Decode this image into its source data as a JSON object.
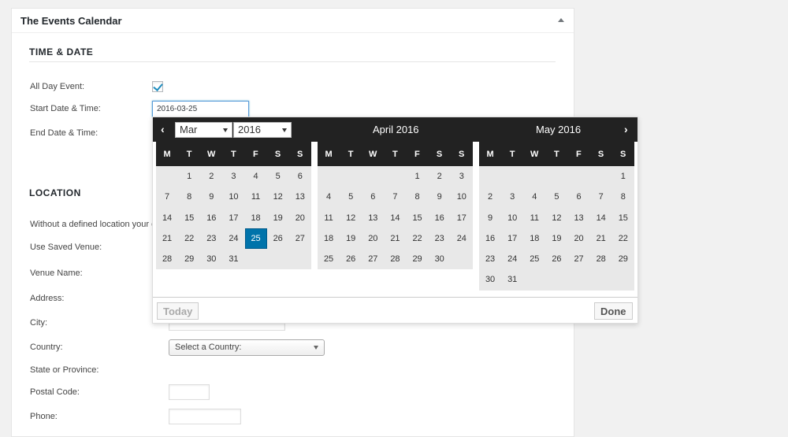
{
  "panel": {
    "title": "The Events Calendar"
  },
  "time_date": {
    "heading": "TIME & DATE",
    "all_day_label": "All Day Event:",
    "all_day_checked": true,
    "start_label": "Start Date & Time:",
    "start_value": "2016-03-25",
    "end_label": "End Date & Time:"
  },
  "location": {
    "heading": "LOCATION",
    "notice": "Without a defined location your e",
    "use_saved_venue_label": "Use Saved Venue:",
    "venue_name_label": "Venue Name:",
    "address_label": "Address:",
    "city_label": "City:",
    "country_label": "Country:",
    "country_select": "Select a Country:",
    "state_label": "State or Province:",
    "postal_label": "Postal Code:",
    "phone_label": "Phone:"
  },
  "datepicker": {
    "prev": "‹",
    "next": "›",
    "month_select": "Mar",
    "year_select": "2016",
    "weekdays": [
      "M",
      "T",
      "W",
      "T",
      "F",
      "S",
      "S"
    ],
    "months": [
      {
        "title": "",
        "days": [
          "",
          "1",
          "2",
          "3",
          "4",
          "5",
          "6",
          "7",
          "8",
          "9",
          "10",
          "11",
          "12",
          "13",
          "14",
          "15",
          "16",
          "17",
          "18",
          "19",
          "20",
          "21",
          "22",
          "23",
          "24",
          "25",
          "26",
          "27",
          "28",
          "29",
          "30",
          "31"
        ],
        "selected": "25"
      },
      {
        "title": "April 2016",
        "days": [
          "",
          "",
          "",
          "",
          "1",
          "2",
          "3",
          "4",
          "5",
          "6",
          "7",
          "8",
          "9",
          "10",
          "11",
          "12",
          "13",
          "14",
          "15",
          "16",
          "17",
          "18",
          "19",
          "20",
          "21",
          "22",
          "23",
          "24",
          "25",
          "26",
          "27",
          "28",
          "29",
          "30"
        ],
        "selected": ""
      },
      {
        "title": "May 2016",
        "days": [
          "",
          "",
          "",
          "",
          "",
          "",
          "1",
          "2",
          "3",
          "4",
          "5",
          "6",
          "7",
          "8",
          "9",
          "10",
          "11",
          "12",
          "13",
          "14",
          "15",
          "16",
          "17",
          "18",
          "19",
          "20",
          "21",
          "22",
          "23",
          "24",
          "25",
          "26",
          "27",
          "28",
          "29",
          "30",
          "31"
        ],
        "selected": ""
      }
    ],
    "today_label": "Today",
    "done_label": "Done"
  }
}
